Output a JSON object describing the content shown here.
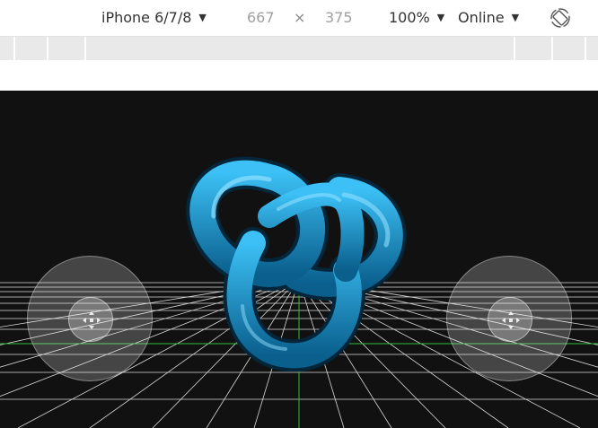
{
  "toolbar": {
    "device": "iPhone 6/7/8",
    "width": "667",
    "times": "×",
    "height": "375",
    "zoom": "100%",
    "network": "Online",
    "caret": "▼",
    "rotate_icon": "rotate-device-icon"
  },
  "viewport": {
    "background": "#111111",
    "object": "torus-knot",
    "object_color": "#1ea8e6",
    "grid_color": "#dddddd",
    "axis_color": "#2fbf3a"
  },
  "controls": {
    "left_joystick": "move-joystick",
    "right_joystick": "look-joystick",
    "knob_icon": "dpad-arrows-icon"
  }
}
